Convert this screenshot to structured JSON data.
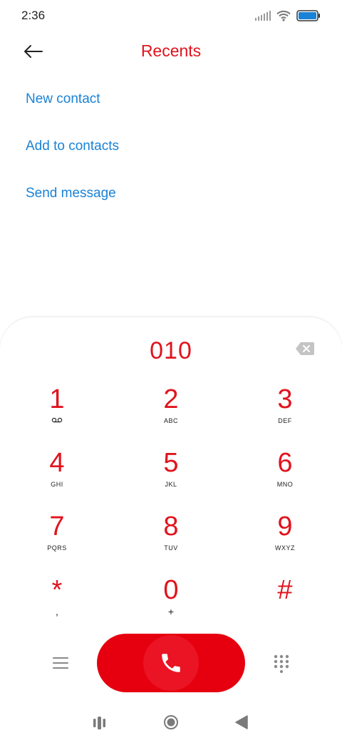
{
  "status_bar": {
    "time": "2:36",
    "icons": [
      "signal-icon",
      "wifi-icon",
      "battery-icon"
    ],
    "battery_color": "#1a82d6"
  },
  "header": {
    "title": "Recents",
    "back_icon": "arrow-left-icon"
  },
  "options": [
    {
      "label": "New contact"
    },
    {
      "label": "Add to contacts"
    },
    {
      "label": "Send message"
    }
  ],
  "dialer": {
    "number": "010",
    "backspace_icon": "backspace-icon",
    "keys": [
      {
        "digit": "1",
        "letters": "",
        "icon": "voicemail-icon"
      },
      {
        "digit": "2",
        "letters": "ABC"
      },
      {
        "digit": "3",
        "letters": "DEF"
      },
      {
        "digit": "4",
        "letters": "GHI"
      },
      {
        "digit": "5",
        "letters": "JKL"
      },
      {
        "digit": "6",
        "letters": "MNO"
      },
      {
        "digit": "7",
        "letters": "PQRS"
      },
      {
        "digit": "8",
        "letters": "TUV"
      },
      {
        "digit": "9",
        "letters": "WXYZ"
      },
      {
        "digit": "*",
        "letters": ","
      },
      {
        "digit": "0",
        "letters": "+"
      },
      {
        "digit": "#",
        "letters": ""
      }
    ],
    "menu_icon": "menu-icon",
    "call_icon": "phone-icon",
    "dialpad_icon": "dialpad-icon"
  },
  "nav_bar": {
    "icons": [
      "recent-apps-icon",
      "home-icon",
      "back-triangle-icon"
    ]
  },
  "colors": {
    "accent": "#e0141e",
    "link": "#1a82d6",
    "call_button": "#e6000f"
  }
}
